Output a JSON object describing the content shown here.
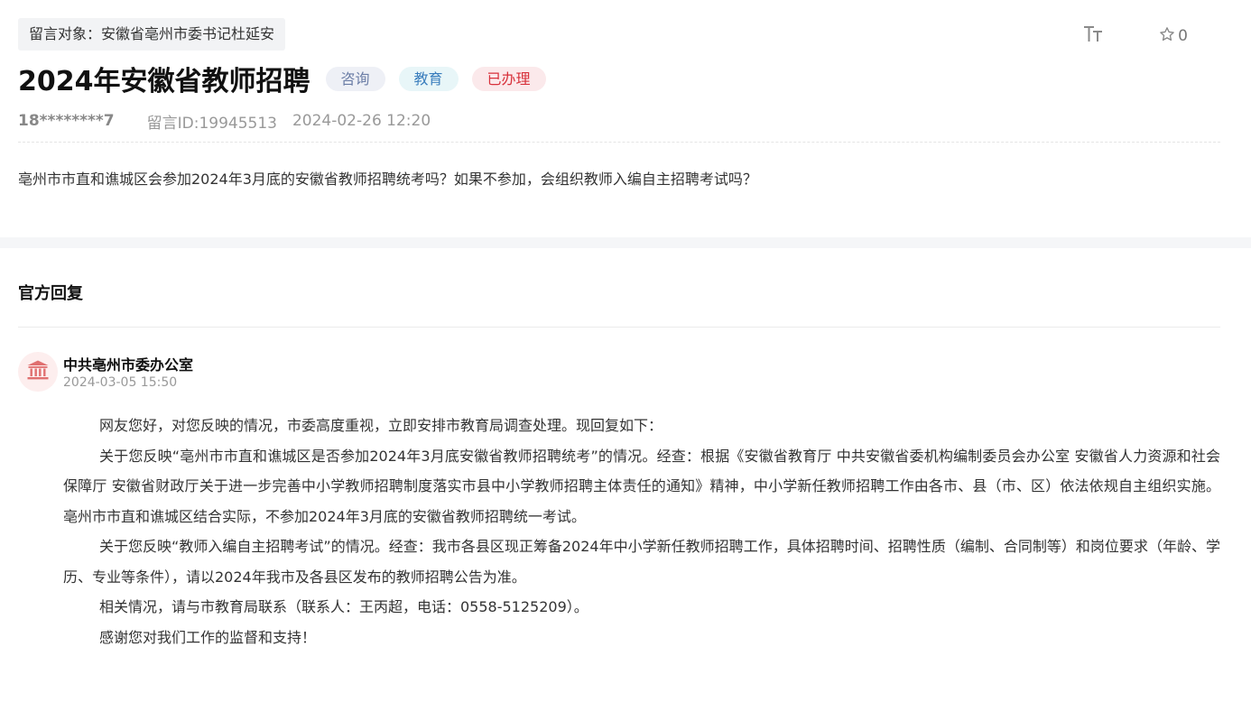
{
  "message": {
    "target_label": "留言对象：安徽省亳州市委书记杜延安",
    "title": "2024年安徽省教师招聘",
    "badges": {
      "type": "咨询",
      "category": "教育",
      "status": "已办理"
    },
    "author": "18********7",
    "message_id": "留言ID:19945513",
    "date": "2024-02-26 12:20",
    "question": "亳州市市直和谯城区会参加2024年3月底的安徽省教师招聘统考吗？如果不参加，会组织教师入编自主招聘考试吗？"
  },
  "toolbar": {
    "font_size_icon": "font-size-icon",
    "favorite_icon": "star-icon",
    "favorite_count": "0"
  },
  "reply": {
    "heading": "官方回复",
    "org_icon": "government-building-icon",
    "org_name": "中共亳州市委办公室",
    "reply_time": "2024-03-05 15:50",
    "paragraphs": [
      "网友您好，对您反映的情况，市委高度重视，立即安排市教育局调查处理。现回复如下：",
      "关于您反映“亳州市市直和谯城区是否参加2024年3月底安徽省教师招聘统考”的情况。经查：根据《安徽省教育厅 中共安徽省委机构编制委员会办公室 安徽省人力资源和社会保障厅 安徽省财政厅关于进一步完善中小学教师招聘制度落实市县中小学教师招聘主体责任的通知》精神，中小学新任教师招聘工作由各市、县（市、区）依法依规自主组织实施。亳州市市直和谯城区结合实际，不参加2024年3月底的安徽省教师招聘统一考试。",
      "关于您反映“教师入编自主招聘考试”的情况。经查：我市各县区现正筹备2024年中小学新任教师招聘工作，具体招聘时间、招聘性质（编制、合同制等）和岗位要求（年龄、学历、专业等条件），请以2024年我市及各县区发布的教师招聘公告为准。",
      "相关情况，请与市教育局联系（联系人：王丙超，电话：0558-5125209）。",
      "感谢您对我们工作的监督和支持！"
    ]
  },
  "colors": {
    "badge_consult_bg": "#eef0f6",
    "badge_edu_bg": "#e8f6f8",
    "badge_done_bg": "#fbe9eb",
    "badge_done_text": "#d8323c",
    "org_icon_color": "#e07070"
  }
}
